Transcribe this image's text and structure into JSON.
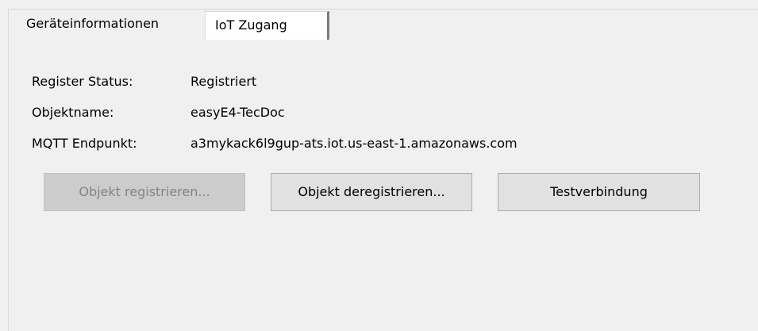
{
  "tabs": [
    {
      "label": "Geräteinformationen",
      "selected": false
    },
    {
      "label": "IoT Zugang",
      "selected": true
    }
  ],
  "info": {
    "register_status_label": "Register Status:",
    "register_status_value": "Registriert",
    "object_name_label": "Objektname:",
    "object_name_value": "easyE4-TecDoc",
    "mqtt_endpoint_label": "MQTT Endpunkt:",
    "mqtt_endpoint_value": "a3mykack6l9gup-ats.iot.us-east-1.amazonaws.com"
  },
  "buttons": {
    "register_label": "Objekt registrieren...",
    "register_enabled": false,
    "deregister_label": "Objekt deregistrieren...",
    "test_connection_label": "Testverbindung"
  },
  "colors": {
    "window_bg": "#f0f0f0",
    "active_tab_bg": "#ffffff",
    "button_bg": "#e1e1e1",
    "disabled_text": "#838383"
  }
}
